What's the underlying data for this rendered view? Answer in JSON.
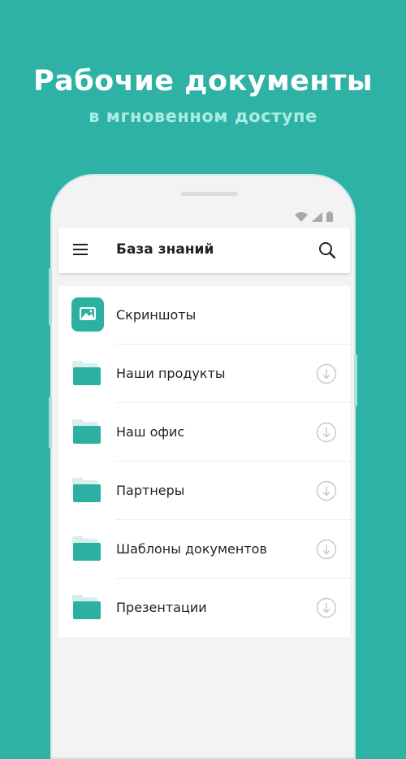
{
  "promo": {
    "headline": "Рабочие документы",
    "subline": "в мгновенном доступе"
  },
  "app": {
    "title": "База знаний",
    "items": [
      {
        "label": "Скриншоты",
        "icon": "image-folder-icon",
        "downloadable": false
      },
      {
        "label": "Наши продукты",
        "icon": "folder-icon",
        "downloadable": true
      },
      {
        "label": "Наш офис",
        "icon": "folder-icon",
        "downloadable": true
      },
      {
        "label": "Партнеры",
        "icon": "folder-icon",
        "downloadable": true
      },
      {
        "label": "Шаблоны документов",
        "icon": "folder-icon",
        "downloadable": true
      },
      {
        "label": "Презентации",
        "icon": "folder-icon",
        "downloadable": true
      }
    ]
  },
  "colors": {
    "background": "#2eb2a5",
    "folder": "#2bb0a1",
    "subline": "#a9ece4"
  }
}
